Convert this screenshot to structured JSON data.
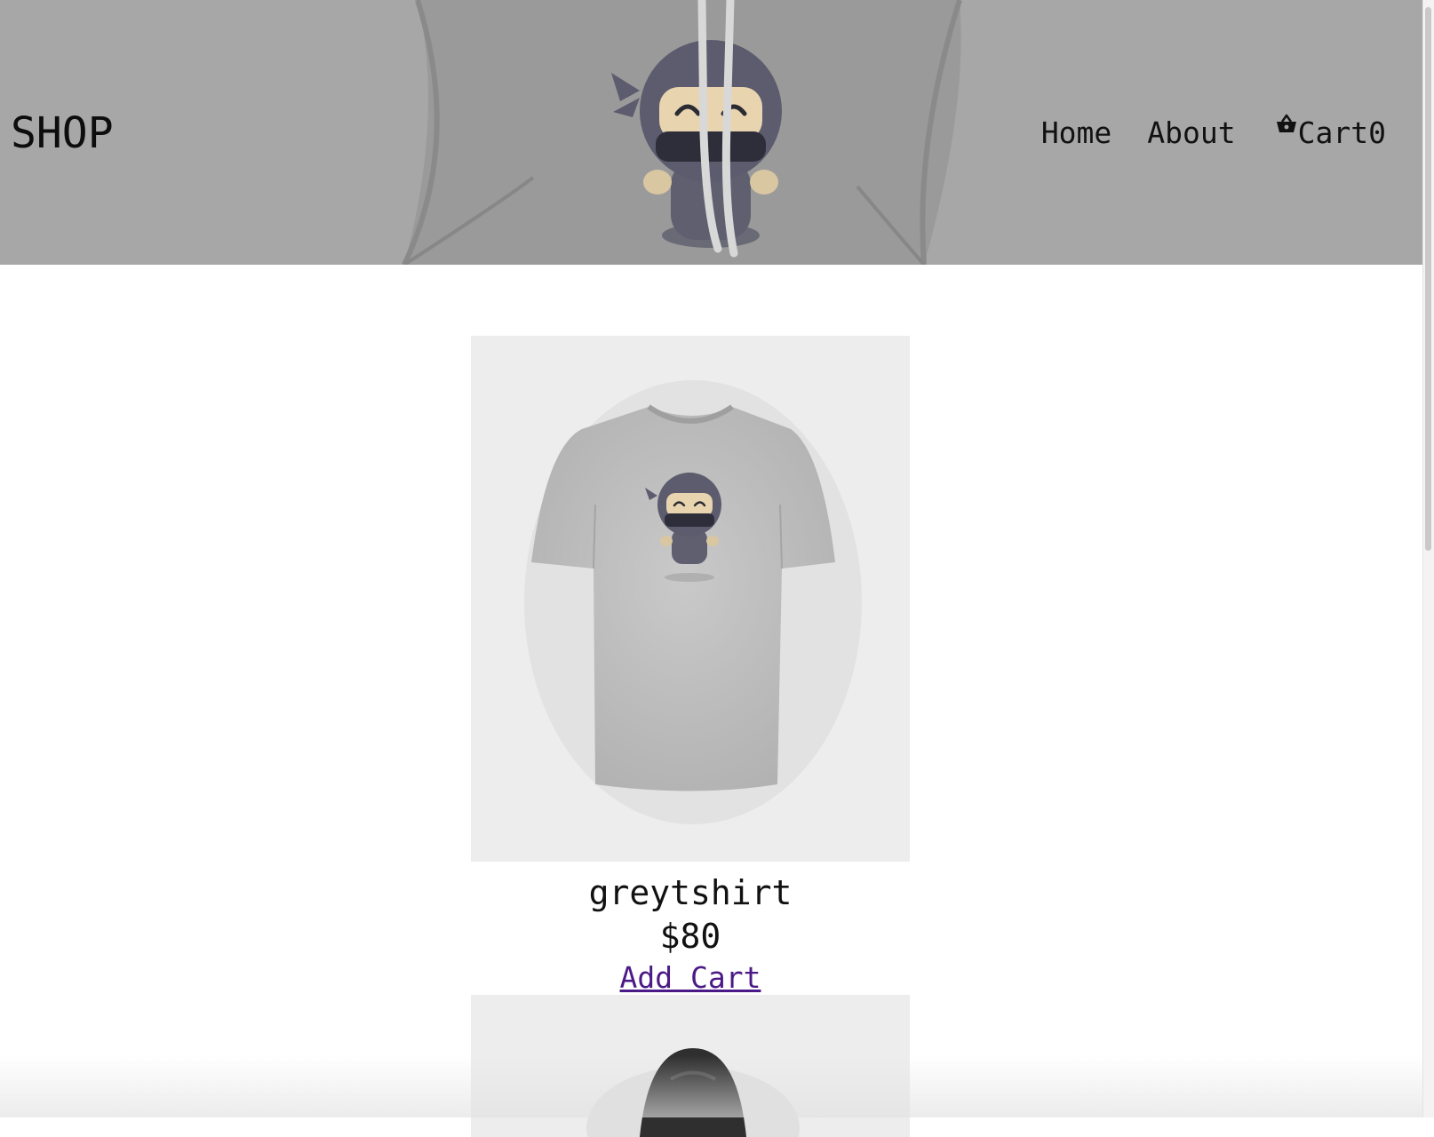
{
  "header": {
    "brand": "SHOP",
    "nav": [
      {
        "label": "Home"
      },
      {
        "label": "About"
      }
    ],
    "cart": {
      "label": "Cart",
      "count": "0",
      "icon": "basket-icon"
    }
  },
  "products": [
    {
      "name": "greytshirt",
      "price": "$80",
      "action": "Add Cart"
    }
  ],
  "colors": {
    "header_bg": "#a7a7a7",
    "product_bg": "#ededed",
    "link": "#4b1a86"
  }
}
